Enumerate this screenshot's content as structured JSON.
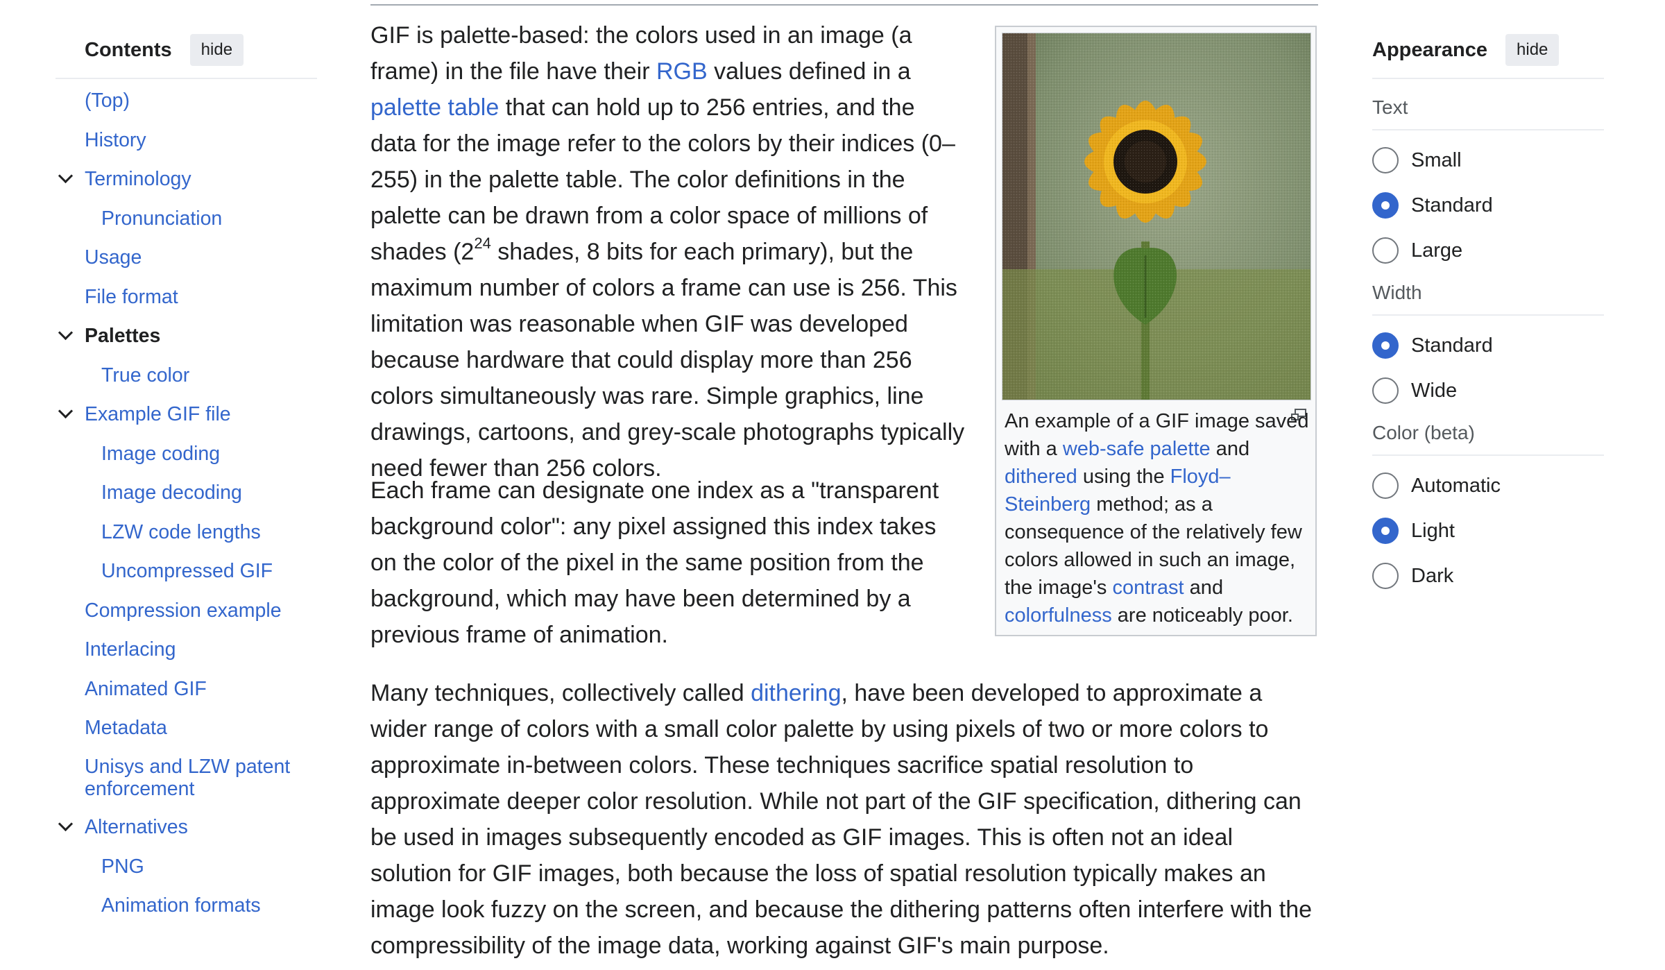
{
  "toc": {
    "title": "Contents",
    "hide_label": "hide",
    "items": [
      {
        "label": "(Top)",
        "level": 1,
        "expandable": false,
        "active": false
      },
      {
        "label": "History",
        "level": 1,
        "expandable": false,
        "active": false
      },
      {
        "label": "Terminology",
        "level": 1,
        "expandable": true,
        "active": false
      },
      {
        "label": "Pronunciation",
        "level": 2,
        "expandable": false,
        "active": false
      },
      {
        "label": "Usage",
        "level": 1,
        "expandable": false,
        "active": false
      },
      {
        "label": "File format",
        "level": 1,
        "expandable": false,
        "active": false
      },
      {
        "label": "Palettes",
        "level": 1,
        "expandable": true,
        "active": true
      },
      {
        "label": "True color",
        "level": 2,
        "expandable": false,
        "active": false
      },
      {
        "label": "Example GIF file",
        "level": 1,
        "expandable": true,
        "active": false
      },
      {
        "label": "Image coding",
        "level": 2,
        "expandable": false,
        "active": false
      },
      {
        "label": "Image decoding",
        "level": 2,
        "expandable": false,
        "active": false
      },
      {
        "label": "LZW code lengths",
        "level": 2,
        "expandable": false,
        "active": false
      },
      {
        "label": "Uncompressed GIF",
        "level": 2,
        "expandable": false,
        "active": false
      },
      {
        "label": "Compression example",
        "level": 1,
        "expandable": false,
        "active": false
      },
      {
        "label": "Interlacing",
        "level": 1,
        "expandable": false,
        "active": false
      },
      {
        "label": "Animated GIF",
        "level": 1,
        "expandable": false,
        "active": false
      },
      {
        "label": "Metadata",
        "level": 1,
        "expandable": false,
        "active": false
      },
      {
        "label": "Unisys and LZW patent enforcement",
        "level": 1,
        "expandable": false,
        "active": false
      },
      {
        "label": "Alternatives",
        "level": 1,
        "expandable": true,
        "active": false
      },
      {
        "label": "PNG",
        "level": 2,
        "expandable": false,
        "active": false
      },
      {
        "label": "Animation formats",
        "level": 2,
        "expandable": false,
        "active": false
      }
    ]
  },
  "article": {
    "p1": {
      "t1": "GIF is palette-based: the colors used in an image (a frame) in the file have their ",
      "link_rgb": "RGB",
      "t2": " values defined in a ",
      "link_palette_table": "palette table",
      "t3": " that can hold up to 256 entries, and the data for the image refer to the colors by their indices (0–255) in the palette table. The color definitions in the palette can be drawn from a color space of millions of shades (2",
      "sup": "24",
      "t4": " shades, 8 bits for each primary), but the maximum number of colors a frame can use is 256. This limitation was reasonable when GIF was developed because hardware that could display more than 256 colors simultaneously was rare. Simple graphics, line drawings, cartoons, and grey-scale photographs typically need fewer than 256 colors."
    },
    "p2": {
      "text": "Each frame can designate one index as a \"transparent background color\": any pixel assigned this index takes on the color of the pixel in the same position from the background, which may have been determined by a previous frame of animation."
    },
    "p3": {
      "t1": "Many techniques, collectively called ",
      "link_dithering": "dithering",
      "t2": ", have been developed to approximate a wider range of colors with a small color palette by using pixels of two or more colors to approximate in-between colors. These techniques sacrifice spatial resolution to approximate deeper color resolution. While not part of the GIF specification, dithering can be used in images subsequently encoded as GIF images. This is often not an ideal solution for GIF images, both because the loss of spatial resolution typically makes an image look fuzzy on the screen, and because the dithering patterns often interfere with the compressibility of the image data, working against GIF's main purpose."
    }
  },
  "figure": {
    "caption": {
      "t1": "An example of a GIF image saved with a ",
      "link_websafe": "web-safe palette",
      "t2": " and ",
      "link_dithered": "dithered",
      "t3": " using the ",
      "link_floyd": "Floyd–Steinberg",
      "t4": " method; as a consequence of the relatively few colors allowed in such an image, the image's ",
      "link_contrast": "contrast",
      "t5": " and ",
      "link_colorfulness": "colorfulness",
      "t6": " are noticeably poor."
    }
  },
  "appearance": {
    "title": "Appearance",
    "hide_label": "hide",
    "groups": [
      {
        "label": "Text",
        "options": [
          {
            "label": "Small",
            "checked": false
          },
          {
            "label": "Standard",
            "checked": true
          },
          {
            "label": "Large",
            "checked": false
          }
        ]
      },
      {
        "label": "Width",
        "options": [
          {
            "label": "Standard",
            "checked": true
          },
          {
            "label": "Wide",
            "checked": false
          }
        ]
      },
      {
        "label": "Color (beta)",
        "options": [
          {
            "label": "Automatic",
            "checked": false
          },
          {
            "label": "Light",
            "checked": true
          },
          {
            "label": "Dark",
            "checked": false
          }
        ]
      }
    ]
  },
  "colors": {
    "link": "#3366cc",
    "text": "#202122",
    "accent": "#3366cc"
  }
}
